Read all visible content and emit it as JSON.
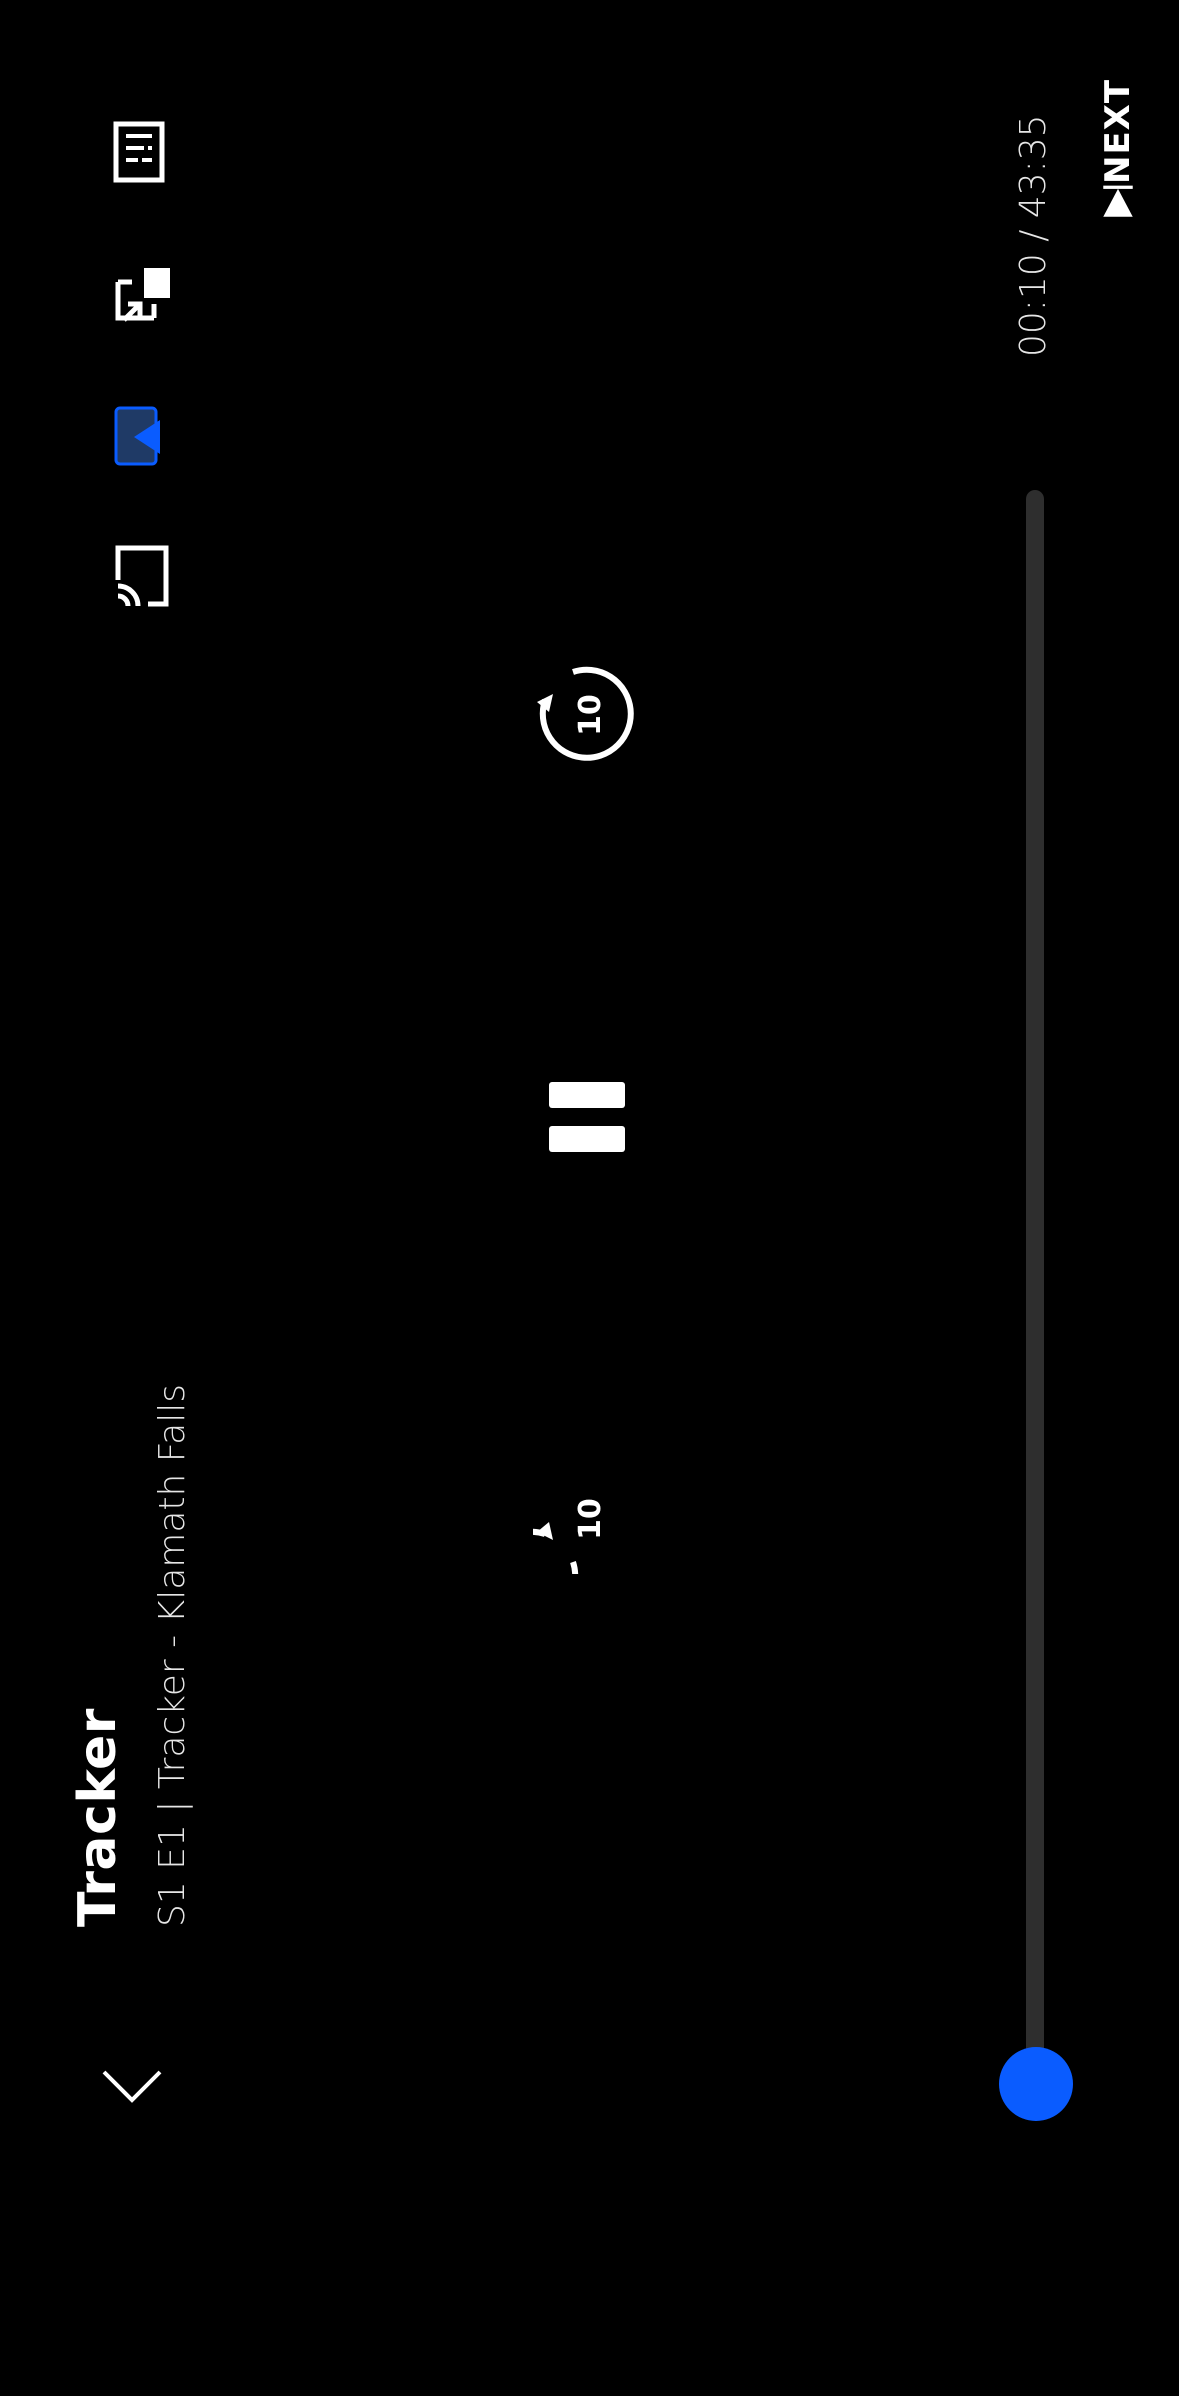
{
  "player": {
    "title": "Tracker",
    "subtitle": "S1 E1 | Tracker - Klamath Falls",
    "time_display": "00:10 / 43:35",
    "next_label": "NEXT",
    "skip_seconds": "10",
    "progress_fraction": 0.004
  },
  "icons": {
    "episodes": "episodes-list-icon",
    "picture_in_picture": "picture-in-picture-icon",
    "brand": "brand-logo-icon",
    "cast": "cast-icon",
    "back": "chevron-down-icon",
    "rewind": "rewind-10-icon",
    "pause": "pause-icon",
    "forward": "forward-10-icon",
    "next": "next-episode-icon"
  },
  "colors": {
    "accent": "#0a5cff",
    "background": "#000000",
    "track": "#2e2e2e"
  }
}
